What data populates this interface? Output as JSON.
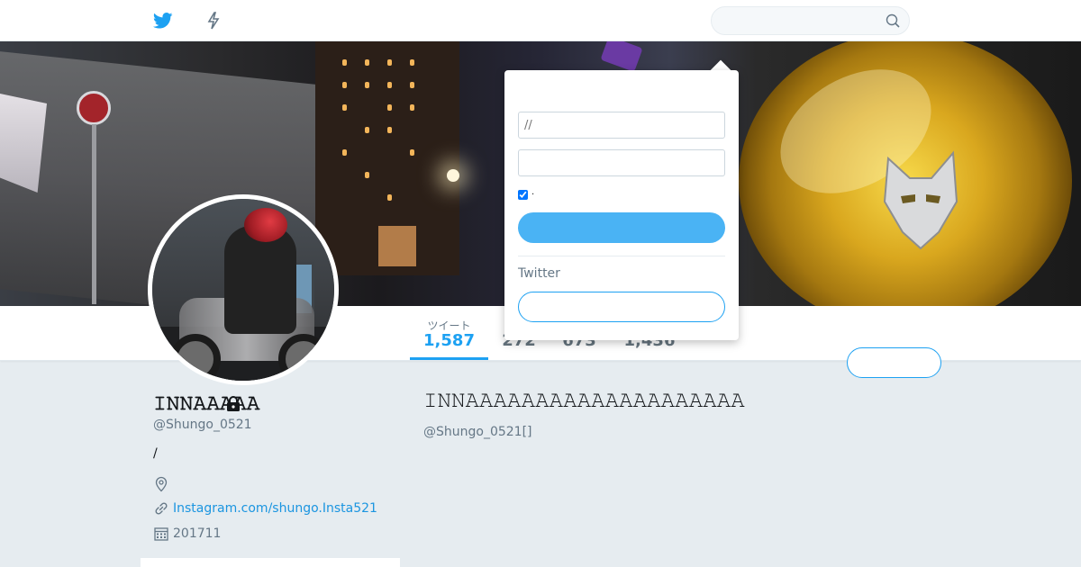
{
  "colors": {
    "brand": "#1da1f2",
    "login_button": "#4ab3f4",
    "link": "#1b95e0",
    "secondary_text": "#657786",
    "background": "#e6ecf0"
  },
  "nav": {
    "home_icon": "twitter-bird-icon",
    "moments_icon": "lightning-bolt-icon",
    "search": {
      "placeholder": "",
      "icon": "magnifier-icon"
    }
  },
  "login": {
    "username_placeholder": "//",
    "password_placeholder": "",
    "remember_label": "·",
    "remember_checked": true,
    "login_button_label": "",
    "signup_prompt": "Twitter",
    "signup_button_label": ""
  },
  "profile": {
    "display_name": "𝙸𝙽𝙽𝙰𝙰𝙰𝙰𝙰",
    "screen_name": "@Shungo_0521",
    "bio": "/",
    "location": "",
    "url": "Instagram.com/shungo.Insta521",
    "joined": "201711",
    "follow_button_label": "",
    "stats": [
      {
        "label": "ツイート",
        "value": "1,587"
      },
      {
        "label": "",
        "value": "272"
      },
      {
        "label": "",
        "value": "673"
      },
      {
        "label": "",
        "value": "1,436"
      }
    ]
  },
  "timeline": {
    "protected_title": "𝙸𝙽𝙽𝙰𝙰𝙰𝙰𝙰𝙰𝙰𝙰𝙰𝙰𝙰𝙰𝙰𝙰𝙰𝙰𝙰𝙰𝙰𝙰",
    "protected_subtitle": "@Shungo_0521[]"
  }
}
